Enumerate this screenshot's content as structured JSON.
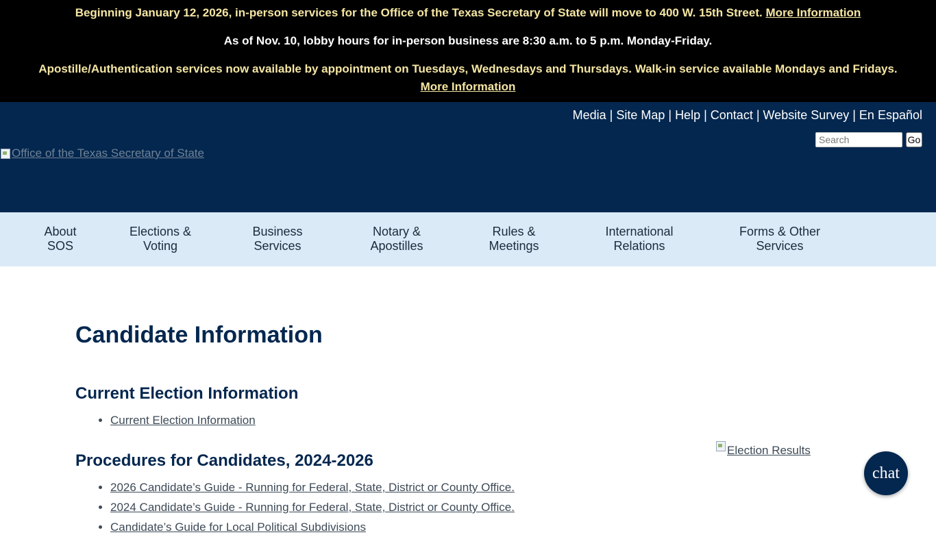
{
  "alerts": {
    "line1_text": "Beginning January 12, 2026, in-person services for the Office of the Texas Secretary of State will move to 400 W. 15th Street.",
    "line1_link": "More Information",
    "line2_text": "As of Nov. 10, lobby hours for in-person business are 8:30 a.m. to 5 p.m. Monday-Friday.",
    "line3_text": "Apostille/Authentication services now available by appointment on Tuesdays, Wednesdays and Thursdays. Walk-in service available Mondays and Fridays.",
    "line3_link": "More Information"
  },
  "header": {
    "utility_links": [
      "Media",
      "Site Map",
      "Help",
      "Contact",
      "Website Survey",
      "En Español"
    ],
    "separator": "|",
    "search_placeholder": "Search",
    "go_label": "Go",
    "logo_alt": "Office of the Texas Secretary of State"
  },
  "nav": {
    "items": [
      {
        "line1": "About",
        "line2": "SOS"
      },
      {
        "line1": "Elections &",
        "line2": "Voting"
      },
      {
        "line1": "Business",
        "line2": "Services"
      },
      {
        "line1": "Notary &",
        "line2": "Apostilles"
      },
      {
        "line1": "Rules &",
        "line2": "Meetings"
      },
      {
        "line1": "International",
        "line2": "Relations"
      },
      {
        "line1": "Forms & Other",
        "line2": "Services"
      }
    ]
  },
  "main": {
    "title": "Candidate Information",
    "sections": [
      {
        "heading": "Current Election Information",
        "links": [
          "Current Election Information"
        ]
      },
      {
        "heading": "Procedures for Candidates, 2024-2026",
        "links": [
          "2026 Candidate’s Guide - Running for Federal, State, District or County Office.",
          "2024 Candidate’s Guide - Running for Federal, State, District or County Office.",
          "Candidate’s Guide for Local Political Subdivisions"
        ]
      }
    ],
    "sidebar_image_alt": "Election Results"
  },
  "chat": {
    "label": "chat"
  },
  "colors": {
    "banner_bg": "#000000",
    "banner_text": "#f5e6a3",
    "header_bg": "#04274f",
    "nav_bg": "#dbeaf7",
    "heading": "#04274f"
  },
  "icons": {
    "logo": "broken-image-icon",
    "election_results": "broken-image-icon"
  }
}
